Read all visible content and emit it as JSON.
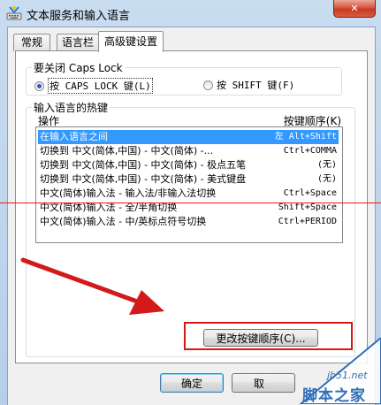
{
  "window": {
    "title": "文本服务和输入语言",
    "close_glyph": "✕"
  },
  "tabs": [
    {
      "label": "常规",
      "active": false
    },
    {
      "label": "语言栏",
      "active": false
    },
    {
      "label": "高级键设置",
      "active": true
    }
  ],
  "caps_lock": {
    "title": "要关闭 Caps Lock",
    "options": [
      {
        "label": "按 CAPS LOCK 键(L)",
        "checked": true
      },
      {
        "label": "按 SHIFT 键(F)",
        "checked": false
      }
    ]
  },
  "hotkeys": {
    "title": "输入语言的热键",
    "col_action": "操作",
    "col_keys": "按键顺序(K)",
    "rows": [
      {
        "action": "在输入语言之间",
        "keys": "左 Alt+Shift",
        "selected": true
      },
      {
        "action": "切换到 中文(简体,中国) - 中文(简体) -...",
        "keys": "Ctrl+COMMA",
        "selected": false
      },
      {
        "action": "切换到 中文(简体,中国) - 中文(简体) - 极点五笔",
        "keys": "(无)",
        "selected": false
      },
      {
        "action": "切换到 中文(简体,中国) - 中文(简体) - 美式键盘",
        "keys": "(无)",
        "selected": false
      },
      {
        "action": "中文(简体)输入法 - 输入法/非输入法切换",
        "keys": "Ctrl+Space",
        "selected": false
      },
      {
        "action": "中文(简体)输入法 - 全/半角切换",
        "keys": "Shift+Space",
        "selected": false
      },
      {
        "action": "中文(简体)输入法 - 中/英标点符号切换",
        "keys": "Ctrl+PERIOD",
        "selected": false
      }
    ],
    "change_button": "更改按键顺序(C)..."
  },
  "footer": {
    "ok": "确定",
    "cancel": "取"
  },
  "watermark": {
    "site": "jb51.net",
    "name": "脚本之家"
  },
  "colors": {
    "selection": "#3399ff",
    "annotation_red": "#d3191a"
  }
}
